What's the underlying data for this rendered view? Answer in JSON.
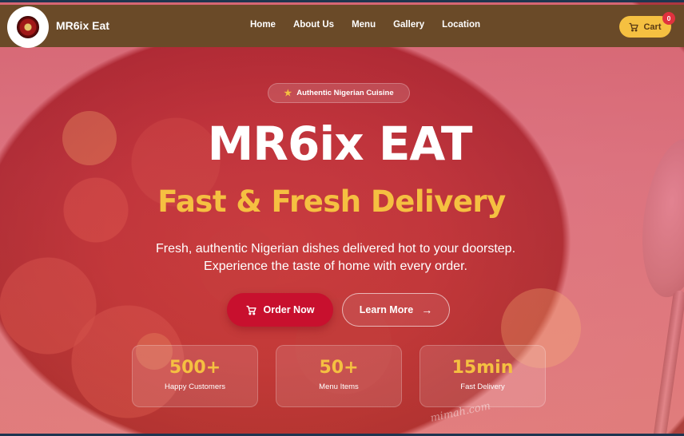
{
  "navbar": {
    "brand": "MR6ix Eat",
    "links": [
      "Home",
      "About Us",
      "Menu",
      "Gallery",
      "Location"
    ],
    "cart_label": "Cart",
    "cart_count": "0"
  },
  "hero": {
    "badge": "Authentic Nigerian Cuisine",
    "title": "MR6ix EAT",
    "subtitle": "Fast & Fresh Delivery",
    "description": "Fresh, authentic Nigerian dishes delivered hot to your doorstep. Experience the taste of home with every order.",
    "order_button": "Order Now",
    "learn_button": "Learn More",
    "stats": [
      {
        "value": "500+",
        "label": "Happy Customers"
      },
      {
        "value": "50+",
        "label": "Menu Items"
      },
      {
        "value": "15min",
        "label": "Fast Delivery"
      }
    ],
    "watermark": "mimah.com"
  },
  "colors": {
    "accent": "#f5c041",
    "primary": "#c8102e",
    "navbar": "#6a4a28",
    "badge": "#e0313e"
  },
  "icons": {
    "star": "star-icon",
    "cart": "cart-icon",
    "arrow": "arrow-right-icon",
    "logo": "brand-logo"
  }
}
